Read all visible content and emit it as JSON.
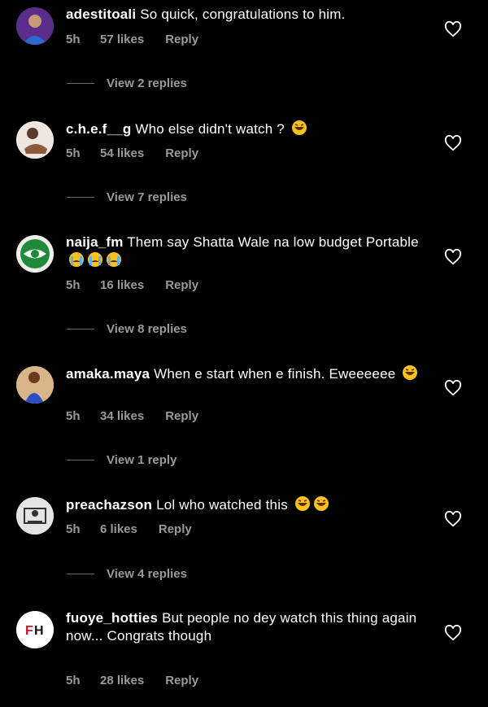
{
  "comments": [
    {
      "username": "adestitoali",
      "text": "So quick, congratulations to him.",
      "time": "5h",
      "likes": "57 likes",
      "reply": "Reply",
      "view_replies": "View 2 replies",
      "avatar": "avatar-purple"
    },
    {
      "username": "c.h.e.f__g",
      "text": "Who else didn't watch ?",
      "time": "5h",
      "likes": "54 likes",
      "reply": "Reply",
      "view_replies": "View 7 replies",
      "avatar": "avatar-light"
    },
    {
      "username": "naija_fm",
      "text": "Them say Shatta Wale na low budget Portable",
      "time": "5h",
      "likes": "16 likes",
      "reply": "Reply",
      "view_replies": "View 8 replies",
      "avatar": "avatar-logo"
    },
    {
      "username": "amaka.maya",
      "text": "When e start when e finish. Eweeeeee",
      "time": "5h",
      "likes": "34 likes",
      "reply": "Reply",
      "view_replies": "View 1 reply",
      "avatar": "avatar-person"
    },
    {
      "username": "preachazson",
      "text": "Lol who watched this",
      "time": "5h",
      "likes": "6 likes",
      "reply": "Reply",
      "view_replies": "View 4 replies",
      "avatar": "avatar-sketch"
    },
    {
      "username": "fuoye_hotties",
      "text": "But people no dey watch this thing again now... Congrats though",
      "time": "5h",
      "likes": "28 likes",
      "reply": "Reply",
      "view_replies": "",
      "avatar": "avatar-fh-logo"
    }
  ],
  "icons": {
    "like": "heart-outline-icon",
    "laughing": "laughing-emoji",
    "crying": "crying-emoji"
  },
  "colors": {
    "background": "#000000",
    "text": "#ffffff",
    "muted": "#9a9a9a"
  }
}
